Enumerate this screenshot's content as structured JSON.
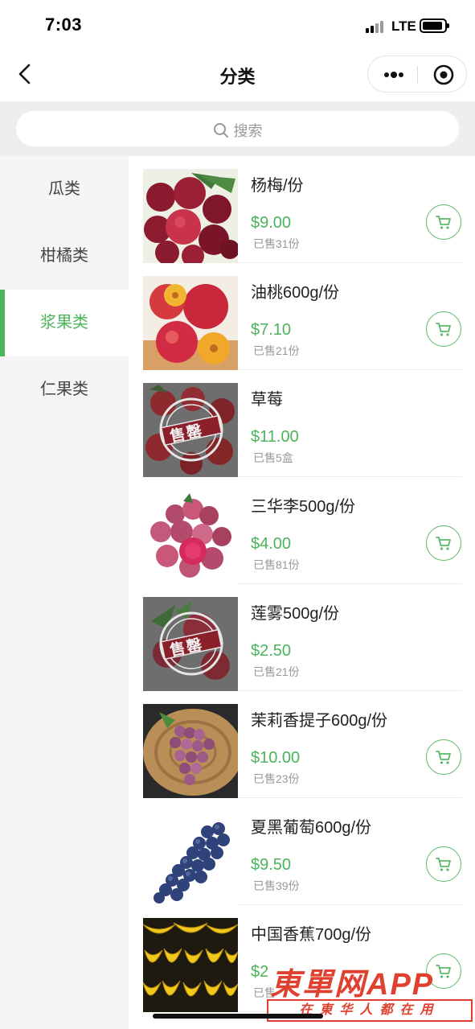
{
  "status_bar": {
    "time": "7:03",
    "network": "LTE"
  },
  "nav": {
    "title": "分类"
  },
  "search": {
    "placeholder": "搜索"
  },
  "categories": [
    {
      "label": "瓜类",
      "active": false
    },
    {
      "label": "柑橘类",
      "active": false
    },
    {
      "label": "浆果类",
      "active": true
    },
    {
      "label": "仁果类",
      "active": false
    }
  ],
  "products": [
    {
      "name": "杨梅/份",
      "price": "$9.00",
      "sold": "已售31份",
      "sold_out": false
    },
    {
      "name": "油桃600g/份",
      "price": "$7.10",
      "sold": "已售21份",
      "sold_out": false
    },
    {
      "name": "草莓",
      "price": "$11.00",
      "sold": "已售5盒",
      "sold_out": true
    },
    {
      "name": "三华李500g/份",
      "price": "$4.00",
      "sold": "已售81份",
      "sold_out": false
    },
    {
      "name": "莲雾500g/份",
      "price": "$2.50",
      "sold": "已售21份",
      "sold_out": true
    },
    {
      "name": "茉莉香提子600g/份",
      "price": "$10.00",
      "sold": "已售23份",
      "sold_out": false
    },
    {
      "name": "夏黑葡萄600g/份",
      "price": "$9.50",
      "sold": "已售39份",
      "sold_out": false
    },
    {
      "name": "中国香蕉700g/份",
      "price": "$2",
      "sold": "已售",
      "sold_out": false
    }
  ],
  "sold_out_stamp": "售罄",
  "watermark": {
    "title": "東單网APP",
    "subtitle": "在東华人都在用"
  },
  "colors": {
    "accent": "#4bb45a",
    "watermark": "#e0402f",
    "sidebar_bg": "#f5f5f5"
  }
}
